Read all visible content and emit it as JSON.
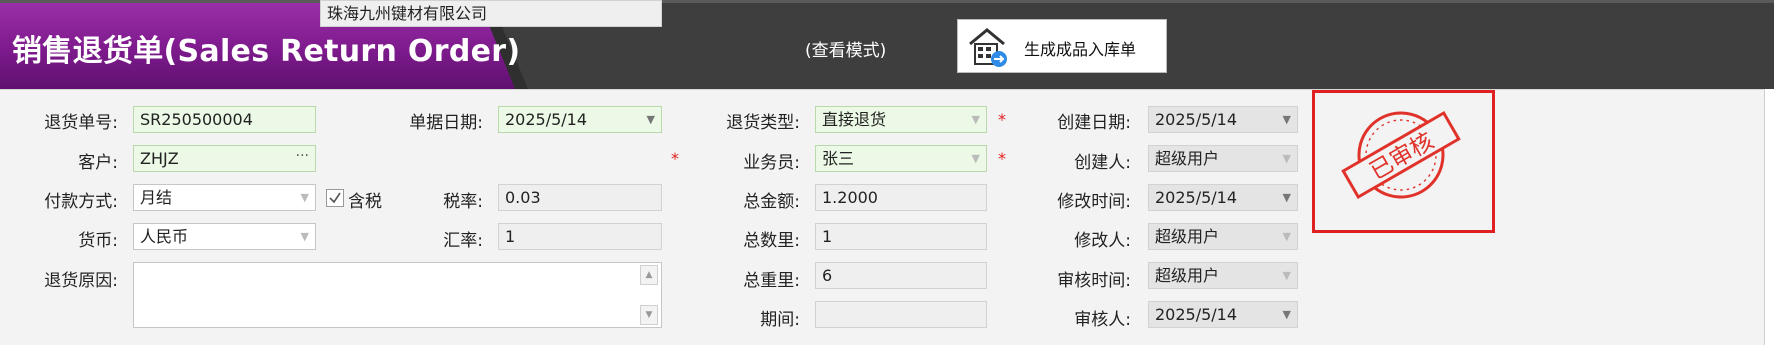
{
  "header": {
    "title": "销售退货单(Sales Return Order)",
    "mode": "(查看模式)",
    "generate_button_label": "生成成品入库单"
  },
  "form": {
    "return_no": {
      "label": "退货单号:",
      "value": "SR250500004"
    },
    "doc_date": {
      "label": "单据日期:",
      "value": "2025/5/14"
    },
    "return_type": {
      "label": "退货类型:",
      "value": "直接退货"
    },
    "create_date": {
      "label": "创建日期:",
      "value": "2025/5/14"
    },
    "customer": {
      "label": "客户:",
      "code": "ZHJZ",
      "name": "珠海九州键材有限公司"
    },
    "salesperson": {
      "label": "业务员:",
      "value": "张三"
    },
    "creator": {
      "label": "创建人:",
      "value": "超级用户"
    },
    "payment_method": {
      "label": "付款方式:",
      "value": "月结"
    },
    "tax_included": {
      "label": "含税",
      "checked": true
    },
    "tax_rate": {
      "label": "税率:",
      "value": "0.03"
    },
    "total_amount": {
      "label": "总金额:",
      "value": "1.2000"
    },
    "modify_time": {
      "label": "修改时间:",
      "value": "2025/5/14"
    },
    "currency": {
      "label": "货币:",
      "value": "人民币"
    },
    "exchange_rate": {
      "label": "汇率:",
      "value": "1"
    },
    "total_qty": {
      "label": "总数里:",
      "value": "1"
    },
    "modifier": {
      "label": "修改人:",
      "value": "超级用户"
    },
    "return_reason": {
      "label": "退货原因:",
      "value": ""
    },
    "total_weight": {
      "label": "总重里:",
      "value": "6"
    },
    "audit_time": {
      "label": "审核时间:",
      "value": "超级用户"
    },
    "period": {
      "label": "期间:",
      "value": ""
    },
    "auditor": {
      "label": "审核人:",
      "value": "2025/5/14"
    }
  },
  "stamp": {
    "text": "已审核",
    "color": "#e02020"
  },
  "colors": {
    "title_purple": "#7d1a8c",
    "header_dark": "#3e3e3e",
    "required_field": "#ebf9e6",
    "required_star": "#e02020"
  }
}
